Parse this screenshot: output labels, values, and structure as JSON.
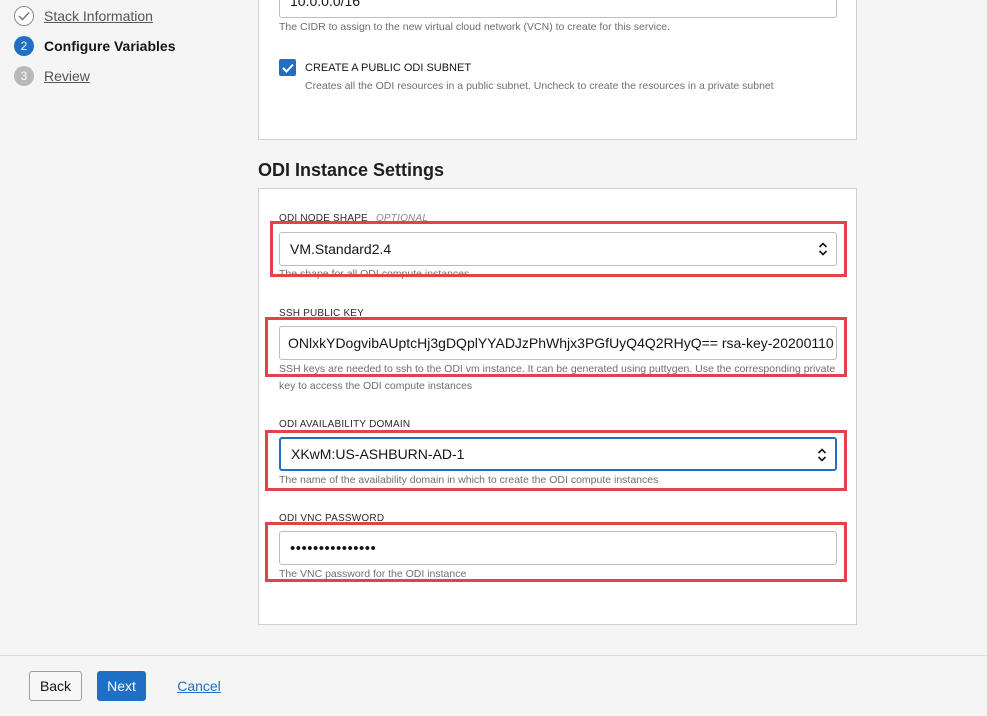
{
  "steps": [
    {
      "number": "",
      "label": "Stack Information",
      "state": "done"
    },
    {
      "number": "2",
      "label": "Configure Variables",
      "state": "active"
    },
    {
      "number": "3",
      "label": "Review",
      "state": "todo"
    }
  ],
  "network": {
    "cidr_value": "10.0.0.0/16",
    "cidr_help": "The CIDR to assign to the new virtual cloud network (VCN) to create for this service.",
    "public_subnet_label": "CREATE A PUBLIC ODI SUBNET",
    "public_subnet_checked": true,
    "public_subnet_help": "Creates all the ODI resources in a public subnet. Uncheck to create the resources in a private subnet"
  },
  "odi_instance": {
    "section_title": "ODI Instance Settings",
    "node_shape": {
      "label": "ODI NODE SHAPE",
      "optional": "OPTIONAL",
      "value": "VM.Standard2.4",
      "help": "The shape for all ODI compute instances"
    },
    "ssh_key": {
      "label": "SSH PUBLIC KEY",
      "value": "ONlxkYDogvibAUptcHj3gDQplYYADJzPhWhjx3PGfUyQ4Q2RHyQ== rsa-key-20200110",
      "help": "SSH keys are needed to ssh to the ODI vm instance. It can be generated using puttygen. Use the corresponding private key to access the ODI compute instances"
    },
    "availability_domain": {
      "label": "ODI AVAILABILITY DOMAIN",
      "value": "XKwM:US-ASHBURN-AD-1",
      "help": "The name of the availability domain in which to create the ODI compute instances"
    },
    "vnc_password": {
      "label": "ODI VNC PASSWORD",
      "value": "•••••••••••••••",
      "help": "The VNC password for the ODI instance"
    }
  },
  "footer": {
    "back_label": "Back",
    "next_label": "Next",
    "cancel_label": "Cancel"
  },
  "colors": {
    "accent": "#1f6fc5",
    "highlight": "#e0434a"
  }
}
